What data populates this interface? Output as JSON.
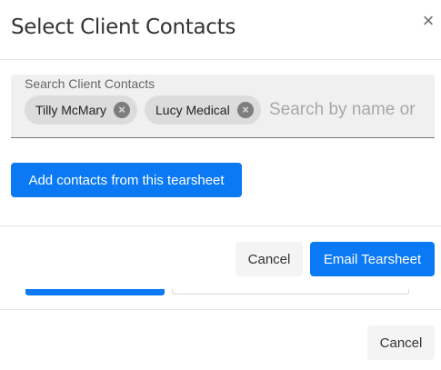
{
  "dialog": {
    "title": "Select Client Contacts",
    "close_symbol": "×"
  },
  "search": {
    "label": "Search Client Contacts",
    "placeholder": "Search by name or",
    "chips": [
      {
        "label": "Tilly McMary",
        "remove_icon": "close-circle-icon"
      },
      {
        "label": "Lucy Medical",
        "remove_icon": "close-circle-icon"
      }
    ],
    "chip_remove_symbol": "×"
  },
  "actions": {
    "add_tearsheet_label": "Add contacts from this tearsheet",
    "cancel_label": "Cancel",
    "email_label": "Email Tearsheet"
  },
  "footer": {
    "cancel_label": "Cancel"
  },
  "colors": {
    "primary": "#0b79f3",
    "chip_bg": "#dcdcdc",
    "input_bg": "#f0f0f0"
  }
}
